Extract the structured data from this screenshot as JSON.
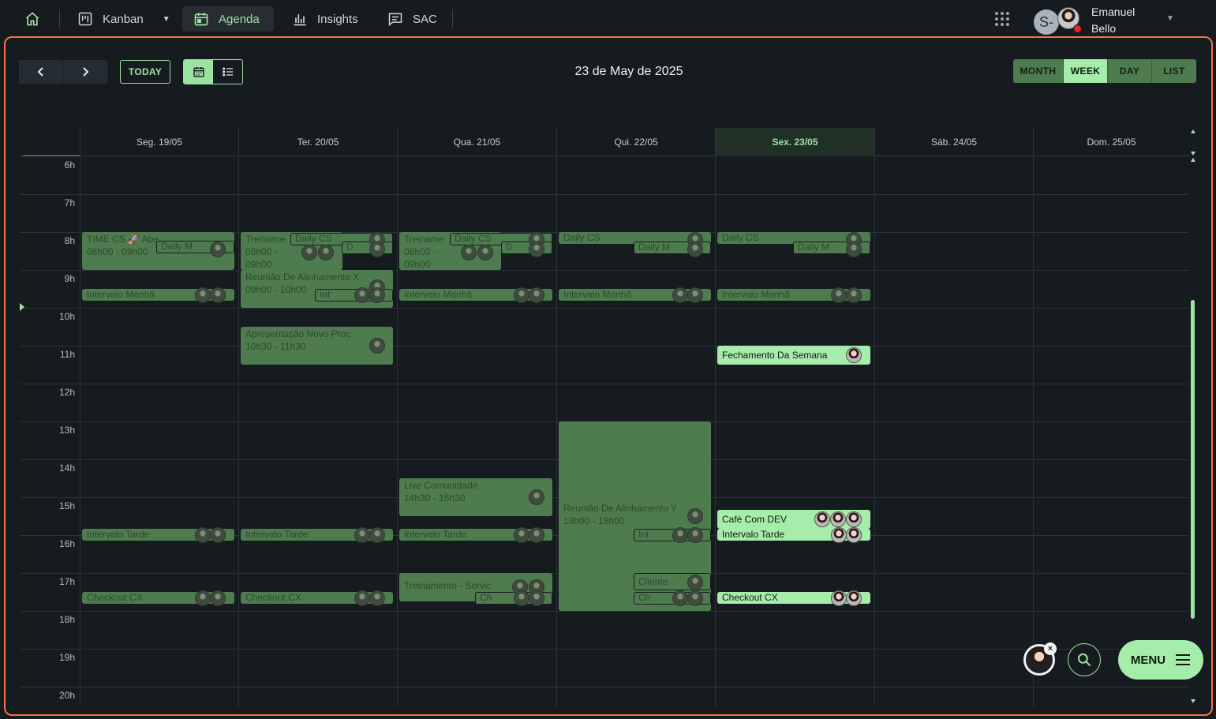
{
  "nav": {
    "items": [
      {
        "label": "Kanban"
      },
      {
        "label": "Agenda"
      },
      {
        "label": "Insights"
      },
      {
        "label": "SAC"
      }
    ],
    "user": {
      "initial": "S-",
      "name_line1": "Emanuel",
      "name_line2": "Bello"
    }
  },
  "toolbar": {
    "today_label": "TODAY",
    "date_title": "23 de May de 2025",
    "views": [
      "MONTH",
      "WEEK",
      "DAY",
      "LIST"
    ],
    "selected_view": "WEEK"
  },
  "calendar": {
    "days": [
      "Seg. 19/05",
      "Ter. 20/05",
      "Qua. 21/05",
      "Qui. 22/05",
      "Sex. 23/05",
      "Sáb. 24/05",
      "Dom. 25/05"
    ],
    "today_index": 4,
    "hours": [
      "6h",
      "7h",
      "8h",
      "9h",
      "10h",
      "11h",
      "12h",
      "13h",
      "14h",
      "15h",
      "16h",
      "17h",
      "18h",
      "19h",
      "20h"
    ],
    "events": {
      "mon_time_cs": {
        "title": "TIME CS 🚀 Abe",
        "time": "08h00 - 09h00"
      },
      "mon_daily": "Daily M",
      "mon_intervalo_manha": "Intervalo Manhã",
      "mon_intervalo_tarde": "Intervalo Tarde",
      "mon_checkout": "Checkout CX",
      "tue_treinamento": {
        "title": "Treiname",
        "time_a": "08h00 -",
        "time_b": "09h00"
      },
      "tue_daily": "Daily CS",
      "tue_d": "D",
      "tue_reuniao": {
        "title": "Reunião De Alinhamento X",
        "time": "09h00 - 10h00"
      },
      "tue_int": "Int",
      "tue_apresentacao": {
        "title": "Apresentação Novo Proc",
        "time": "10h30 - 11h30"
      },
      "tue_intervalo_tarde": "Intervalo Tarde",
      "tue_checkout": "Checkout CX",
      "wed_treinamento": {
        "title": "Treiname",
        "time_a": "08h00 -",
        "time_b": "09h00"
      },
      "wed_daily": "Daily CS",
      "wed_d": "D",
      "wed_intervalo_manha": "Intervalo Manhã",
      "wed_live": {
        "title": "Live Comunidade",
        "time": "14h30 - 15h30"
      },
      "wed_intervalo_tarde": "Intervalo Tarde",
      "wed_treinamento_serv": "Treinamento - Servic",
      "wed_ch": "Ch",
      "thu_daily": "Daily CS",
      "thu_daily_m": "Daily M",
      "thu_intervalo_manha": "Intervalo Manhã",
      "thu_reuniao": {
        "title": "Reunião De Alinhamento Y",
        "time": "13h00 - 18h00"
      },
      "thu_int": "Int",
      "thu_cliente": "Cliente",
      "thu_ch": "Ch",
      "fri_daily": "Daily CS",
      "fri_daily_m": "Daily M",
      "fri_intervalo_manha": "Intervalo Manhã",
      "fri_fechamento": "Fechamento Da Semana",
      "fri_cafe": "Café Com DEV",
      "fri_intervalo_tarde": "Intervalo Tarde",
      "fri_checkout": "Checkout CX"
    }
  },
  "fab": {
    "close": "×",
    "menu_label": "MENU"
  },
  "colors": {
    "accent": "#9ce3a2",
    "frame": "#f2734a",
    "past_event": "#4e7c4f",
    "current_event": "#a6ecaa"
  }
}
